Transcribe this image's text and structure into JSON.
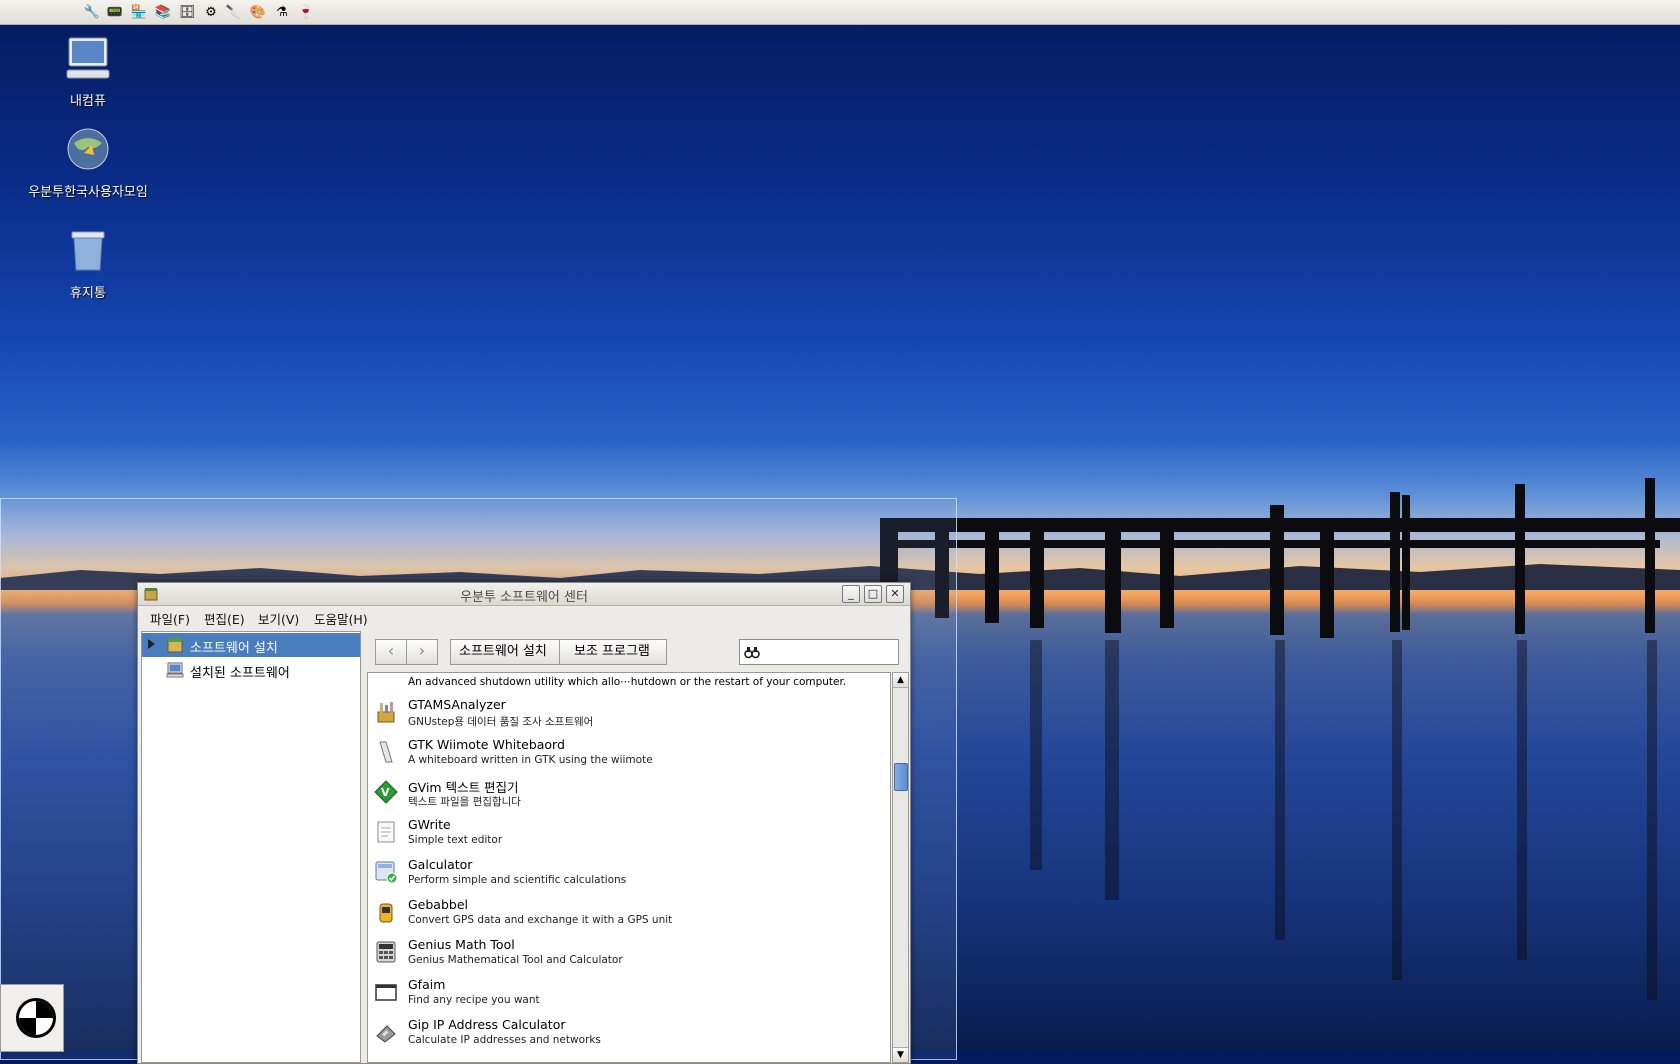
{
  "desktop": {
    "icons": [
      {
        "label": "내컴퓨",
        "icon": "computer-icon"
      },
      {
        "label": "우분투한국사용자모임",
        "icon": "globe-icon"
      },
      {
        "label": "휴지통",
        "icon": "trash-icon"
      }
    ]
  },
  "panel": {
    "launchers": [
      "preferences-tools-icon",
      "system-monitor-icon",
      "software-center-icon",
      "library-icon",
      "file-cabinet-icon",
      "settings-gear-icon",
      "swiss-knife-icon",
      "graphics-icon",
      "lab-icon",
      "wine-icon"
    ]
  },
  "window": {
    "title": "우분투 소프트웨어 센터",
    "menu": [
      "파일(F)",
      "편집(E)",
      "보기(V)",
      "도움말(H)"
    ],
    "sidebar": [
      {
        "label": "소프트웨어 설치",
        "selected": true
      },
      {
        "label": "설치된 소프트웨어",
        "selected": false
      }
    ],
    "breadcrumb": [
      "소프트웨어 설치",
      "보조 프로그램"
    ],
    "search": {
      "value": "",
      "placeholder": ""
    },
    "partial_item_desc": "An advanced shutdown utility which allo⋯hutdown or the restart of your computer.",
    "items": [
      {
        "name": "GTAMSAnalyzer",
        "desc": "GNUstep용 데이터 품질 조사 소프트웨어",
        "icon": "analyzer-icon",
        "installed": false
      },
      {
        "name": "GTK Wiimote Whitebaord",
        "desc": "A whiteboard written in GTK using the wiimote",
        "icon": "whiteboard-icon",
        "installed": false
      },
      {
        "name": "GVim 텍스트 편집기",
        "desc": "텍스트 파일을 편집합니다",
        "icon": "vim-icon",
        "installed": false
      },
      {
        "name": "GWrite",
        "desc": "Simple text editor",
        "icon": "text-editor-icon",
        "installed": false
      },
      {
        "name": "Galculator",
        "desc": "Perform simple and scientific calculations",
        "icon": "calculator-icon",
        "installed": true
      },
      {
        "name": "Gebabbel",
        "desc": "Convert GPS data and exchange it with a GPS unit",
        "icon": "gps-icon",
        "installed": false
      },
      {
        "name": "Genius Math Tool",
        "desc": "Genius Mathematical Tool and Calculator",
        "icon": "math-tool-icon",
        "installed": false
      },
      {
        "name": "Gfaim",
        "desc": "Find any recipe you want",
        "icon": "window-icon",
        "installed": false
      },
      {
        "name": "Gip IP Address Calculator",
        "desc": "Calculate IP addresses and networks",
        "icon": "ip-calculator-icon",
        "installed": false
      }
    ]
  }
}
